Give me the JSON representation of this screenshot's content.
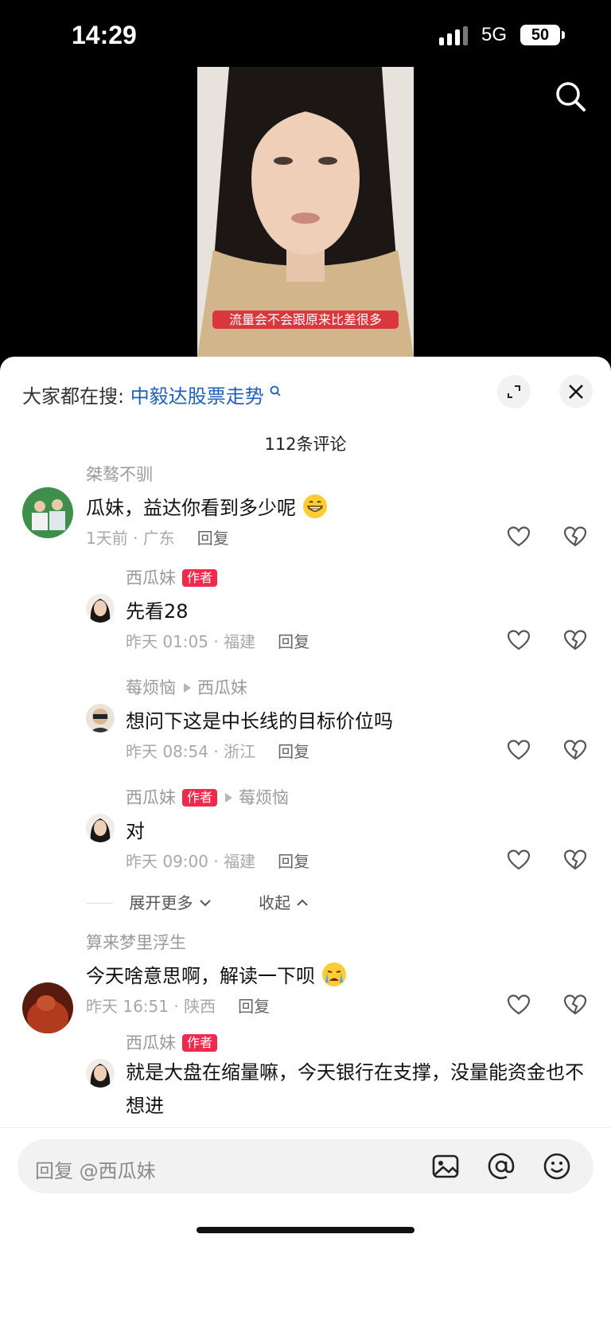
{
  "status_bar": {
    "time": "14:29",
    "network": "5G",
    "battery": "50"
  },
  "video": {
    "subtitle": "流量会不会跟原来比差很多"
  },
  "sheet": {
    "hot_search_label": "大家都在搜:",
    "hot_search_term": "中毅达股票走势",
    "comment_count": "112条评论"
  },
  "comments": [
    {
      "user": "桀骜不驯",
      "text": "瓜妹，益达你看到多少呢",
      "emoji": "grin-emoji",
      "meta": "1天前 · 广东",
      "reply": "回复",
      "replies": [
        {
          "user": "西瓜妹",
          "badge": "作者",
          "text": "先看28",
          "meta": "昨天 01:05 · 福建",
          "reply": "回复"
        },
        {
          "user": "莓烦恼",
          "reply_to": "西瓜妹",
          "text": "想问下这是中长线的目标价位吗",
          "meta": "昨天 08:54 · 浙江",
          "reply": "回复"
        },
        {
          "user": "西瓜妹",
          "badge": "作者",
          "reply_to": "莓烦恼",
          "text": "对",
          "meta": "昨天 09:00 · 福建",
          "reply": "回复"
        }
      ],
      "expand_more": "展开更多",
      "collapse": "收起"
    },
    {
      "user": "算来梦里浮生",
      "text": "今天啥意思啊，解读一下呗",
      "emoji": "crying-emoji",
      "meta": "昨天 16:51 · 陕西",
      "reply": "回复",
      "replies": [
        {
          "user": "西瓜妹",
          "badge": "作者",
          "text": "就是大盘在缩量嘛，今天银行在支撑，没量能资金也不想进"
        }
      ]
    }
  ],
  "input": {
    "placeholder": "回复 @西瓜妹"
  },
  "colors": {
    "accent": "#f0294d",
    "link": "#1f5fb8",
    "subtitle_bg": "#d9363e"
  }
}
